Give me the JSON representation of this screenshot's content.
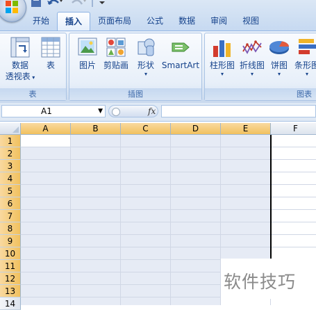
{
  "tabs": [
    "开始",
    "插入",
    "页面布局",
    "公式",
    "数据",
    "审阅",
    "视图"
  ],
  "active_tab": "插入",
  "ribbon": {
    "table_group": {
      "label": "表",
      "pivot_line1": "数据",
      "pivot_line2": "透视表",
      "table": "表"
    },
    "illustrations_group": {
      "label": "插图",
      "picture": "图片",
      "clipart": "剪贴画",
      "shapes": "形状",
      "smartart": "SmartArt"
    },
    "charts_group": {
      "label": "图表",
      "column": "柱形图",
      "line": "折线图",
      "pie": "饼图",
      "bar": "条形图"
    }
  },
  "formula_bar": {
    "name_box": "A1",
    "fx": "fx",
    "formula": ""
  },
  "columns": [
    "A",
    "B",
    "C",
    "D",
    "E",
    "F"
  ],
  "selected_columns": [
    "A",
    "B",
    "C",
    "D",
    "E"
  ],
  "rows": [
    "1",
    "2",
    "3",
    "4",
    "5",
    "6",
    "7",
    "8",
    "9",
    "10",
    "11",
    "12",
    "13",
    "14"
  ],
  "selected_rows": [
    "1",
    "2",
    "3",
    "4",
    "5",
    "6",
    "7",
    "8",
    "9",
    "10",
    "11",
    "12",
    "13"
  ],
  "watermark": "软件技巧",
  "colors": {
    "ribbon_bg": "#dfe9f5",
    "selection_fill": "#e6ebf5",
    "header_selected": "#f1c15f",
    "tab_text": "#15428b"
  }
}
